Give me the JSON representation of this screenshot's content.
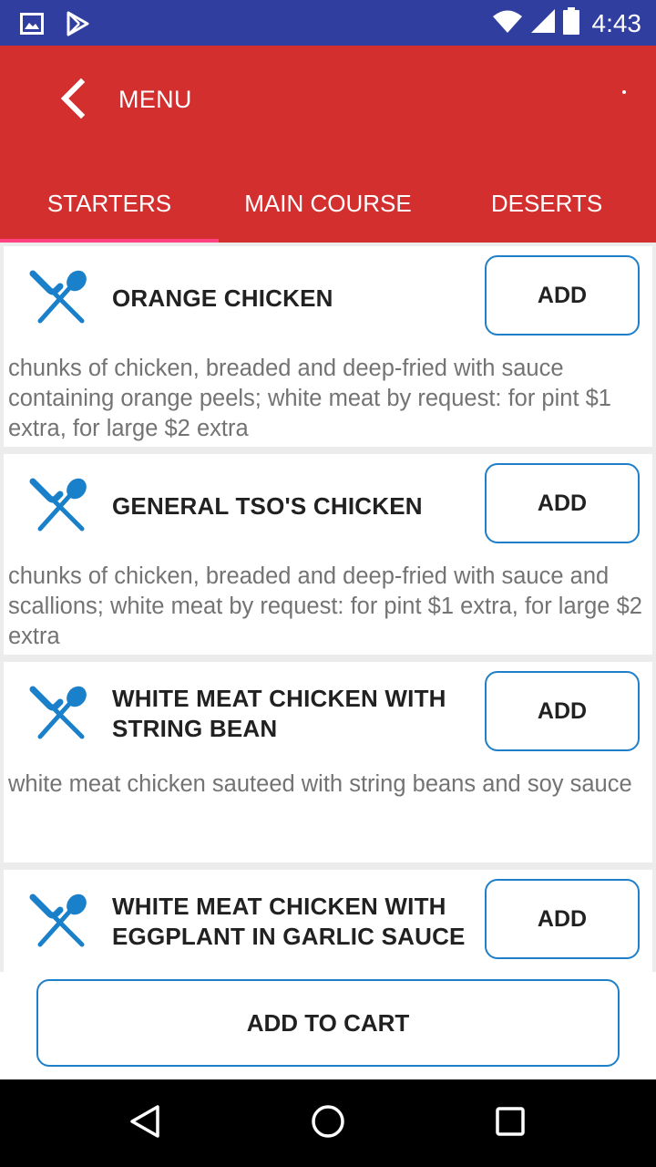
{
  "status_bar": {
    "time": "4:43",
    "icons": [
      "image-icon",
      "play-store-icon",
      "wifi-icon",
      "signal-icon",
      "battery-icon"
    ]
  },
  "app_bar": {
    "title": "MENU",
    "back_icon": "chevron-left-icon"
  },
  "tabs": [
    {
      "label": "STARTERS",
      "active": true
    },
    {
      "label": "MAIN COURSE",
      "active": false
    },
    {
      "label": "DESERTS",
      "active": false
    }
  ],
  "menu_items": [
    {
      "name": "ORANGE CHICKEN",
      "description": "chunks of chicken, breaded and deep-fried with sauce containing orange peels; white meat by request: for pint $1 extra, for large $2 extra",
      "add_label": "ADD"
    },
    {
      "name": "GENERAL TSO'S CHICKEN",
      "description": "chunks of chicken, breaded and deep-fried with sauce and scallions; white meat by request: for pint $1 extra, for large $2 extra",
      "add_label": "ADD"
    },
    {
      "name": "WHITE MEAT CHICKEN WITH STRING BEAN",
      "description": "white meat chicken sauteed with string beans and soy sauce",
      "add_label": "ADD"
    },
    {
      "name": "WHITE MEAT CHICKEN WITH EGGPLANT IN GARLIC SAUCE",
      "description": "",
      "add_label": "ADD"
    }
  ],
  "footer": {
    "cart_label": "ADD TO CART"
  },
  "nav_bar": {
    "icons": [
      "back-triangle-icon",
      "home-circle-icon",
      "recents-square-icon"
    ]
  },
  "colors": {
    "status_bar": "#303f9f",
    "app_bar": "#d32f2f",
    "tab_indicator": "#ff4081",
    "accent": "#1f7fc8",
    "icon": "#1a80c9"
  }
}
